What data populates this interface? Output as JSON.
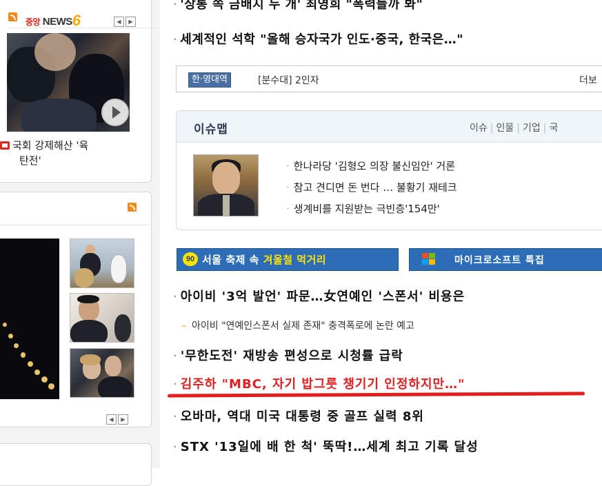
{
  "left": {
    "news6": {
      "logo_prefix": "중앙",
      "logo_news": "NEWS",
      "logo_six": "6",
      "pager_prev": "◀",
      "pager_next": "▶",
      "video_caption_line1": "국회 강제해산 '육",
      "video_caption_line2": "탄전'"
    },
    "photo": {
      "pager_prev": "◀",
      "pager_next": "▶"
    }
  },
  "main": {
    "headlines": [
      "'상통 쪽 금배지 두 개' 최영희 \"폭력들까 봐\"",
      "세계적인 석학 \"올해 승자국가 인도·중국, 한국은…\""
    ],
    "dictionary": {
      "tag": "한·영대역",
      "text": "[분수대] 2인자",
      "more": "더보"
    },
    "issue_map": {
      "title": "이슈맵",
      "categories": [
        "이슈",
        "인물",
        "기업",
        "국"
      ],
      "items": [
        "한나라당 '김형오 의장 불신임안' 거론",
        "참고 견디면 돈 번다 … 불황기 재테크",
        "생계비를 지원받는 극빈층'154만'"
      ]
    },
    "banners": {
      "festival_badge": "90",
      "festival_pre": "서울 축제 속 ",
      "festival_highlight": "겨울철 먹거리",
      "ms": "마이크로소프트 특집"
    },
    "news": [
      "아이비 '3억 발언' 파문…女연예인 '스폰서' 비용은",
      "'무한도전' 재방송 편성으로 시청률 급락",
      "김주하 \"MBC, 자기 밥그릇 챙기기 인정하지만…\"",
      "오바마, 역대 미국 대통령 중 골프 실력 8위",
      "STX '13일에 배 한 척' 뚝딱!…세계 최고 기록 달성"
    ],
    "sub_news": "아이비 \"연예인스폰서 실제 존재\" 충격폭로에 논란 예고",
    "bullet": "·",
    "sub_bullet": "–"
  },
  "colors": {
    "accent_blue": "#2d6db8",
    "highlight_red": "#e02020",
    "rss_orange": "#f08a1c",
    "badge_yellow": "#ffe300"
  }
}
